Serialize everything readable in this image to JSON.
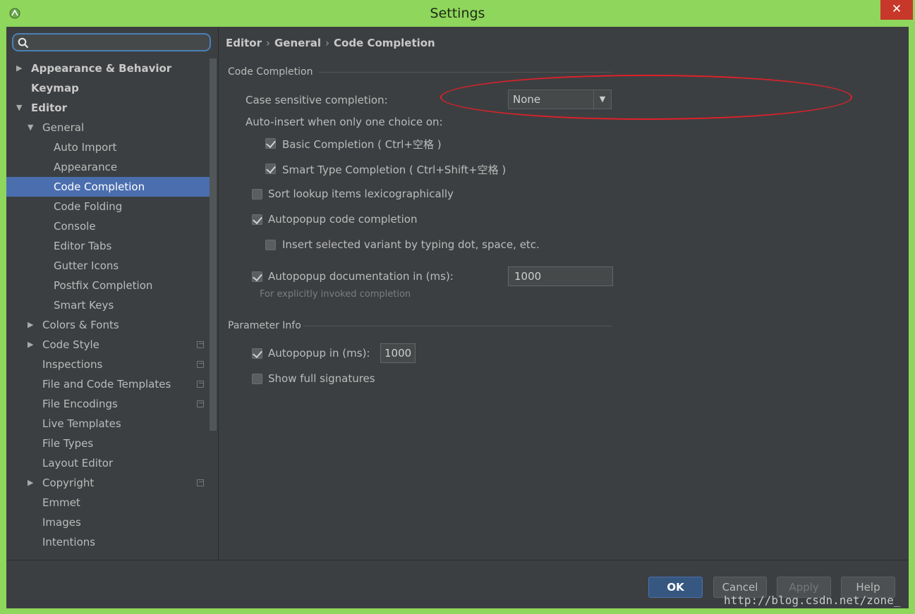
{
  "window": {
    "title": "Settings",
    "close_glyph": "✕"
  },
  "search": {
    "placeholder": "",
    "value": ""
  },
  "sidebar": {
    "items": [
      {
        "label": "Appearance & Behavior",
        "level": 0,
        "arrow": "right",
        "bold": true
      },
      {
        "label": "Keymap",
        "level": 0,
        "arrow": "none",
        "bold": true
      },
      {
        "label": "Editor",
        "level": 0,
        "arrow": "down",
        "bold": true
      },
      {
        "label": "General",
        "level": 1,
        "arrow": "down"
      },
      {
        "label": "Auto Import",
        "level": 2
      },
      {
        "label": "Appearance",
        "level": 2
      },
      {
        "label": "Code Completion",
        "level": 2,
        "selected": true
      },
      {
        "label": "Code Folding",
        "level": 2
      },
      {
        "label": "Console",
        "level": 2
      },
      {
        "label": "Editor Tabs",
        "level": 2
      },
      {
        "label": "Gutter Icons",
        "level": 2
      },
      {
        "label": "Postfix Completion",
        "level": 2
      },
      {
        "label": "Smart Keys",
        "level": 2
      },
      {
        "label": "Colors & Fonts",
        "level": 1,
        "arrow": "right"
      },
      {
        "label": "Code Style",
        "level": 1,
        "arrow": "right",
        "project_icon": true
      },
      {
        "label": "Inspections",
        "level": 1,
        "project_icon": true
      },
      {
        "label": "File and Code Templates",
        "level": 1,
        "project_icon": true
      },
      {
        "label": "File Encodings",
        "level": 1,
        "project_icon": true
      },
      {
        "label": "Live Templates",
        "level": 1
      },
      {
        "label": "File Types",
        "level": 1
      },
      {
        "label": "Layout Editor",
        "level": 1
      },
      {
        "label": "Copyright",
        "level": 1,
        "arrow": "right",
        "project_icon": true
      },
      {
        "label": "Emmet",
        "level": 1
      },
      {
        "label": "Images",
        "level": 1
      },
      {
        "label": "Intentions",
        "level": 1
      }
    ]
  },
  "breadcrumb": {
    "part1": "Editor",
    "sep": "›",
    "part2": "General",
    "part3": "Code Completion"
  },
  "code_completion": {
    "group_title": "Code Completion",
    "case_sensitive_label": "Case sensitive completion:",
    "case_sensitive_value": "None",
    "auto_insert_label": "Auto-insert when only one choice on:",
    "basic_completion": {
      "label": "Basic Completion ( Ctrl+空格 )",
      "checked": true
    },
    "smart_type_completion": {
      "label": "Smart Type Completion ( Ctrl+Shift+空格 )",
      "checked": true
    },
    "sort_lookup": {
      "label": "Sort lookup items lexicographically",
      "checked": false
    },
    "autopopup_code": {
      "label": "Autopopup code completion",
      "checked": true
    },
    "insert_selected": {
      "label": "Insert selected variant by typing dot, space, etc.",
      "checked": false
    },
    "autopopup_doc": {
      "label": "Autopopup documentation in (ms):",
      "checked": true,
      "value": "1000"
    },
    "hint": "For explicitly invoked completion"
  },
  "parameter_info": {
    "group_title": "Parameter Info",
    "autopopup": {
      "label": "Autopopup in (ms):",
      "checked": true,
      "value": "1000"
    },
    "show_full_signatures": {
      "label": "Show full signatures",
      "checked": false
    }
  },
  "buttons": {
    "ok": "OK",
    "cancel": "Cancel",
    "apply": "Apply",
    "help": "Help"
  },
  "watermark": "http://blog.csdn.net/zone_",
  "colors": {
    "title_bar": "#8fd65c",
    "panel": "#3c3f41",
    "selection": "#4b6eaf",
    "annotation": "#e0202a"
  }
}
